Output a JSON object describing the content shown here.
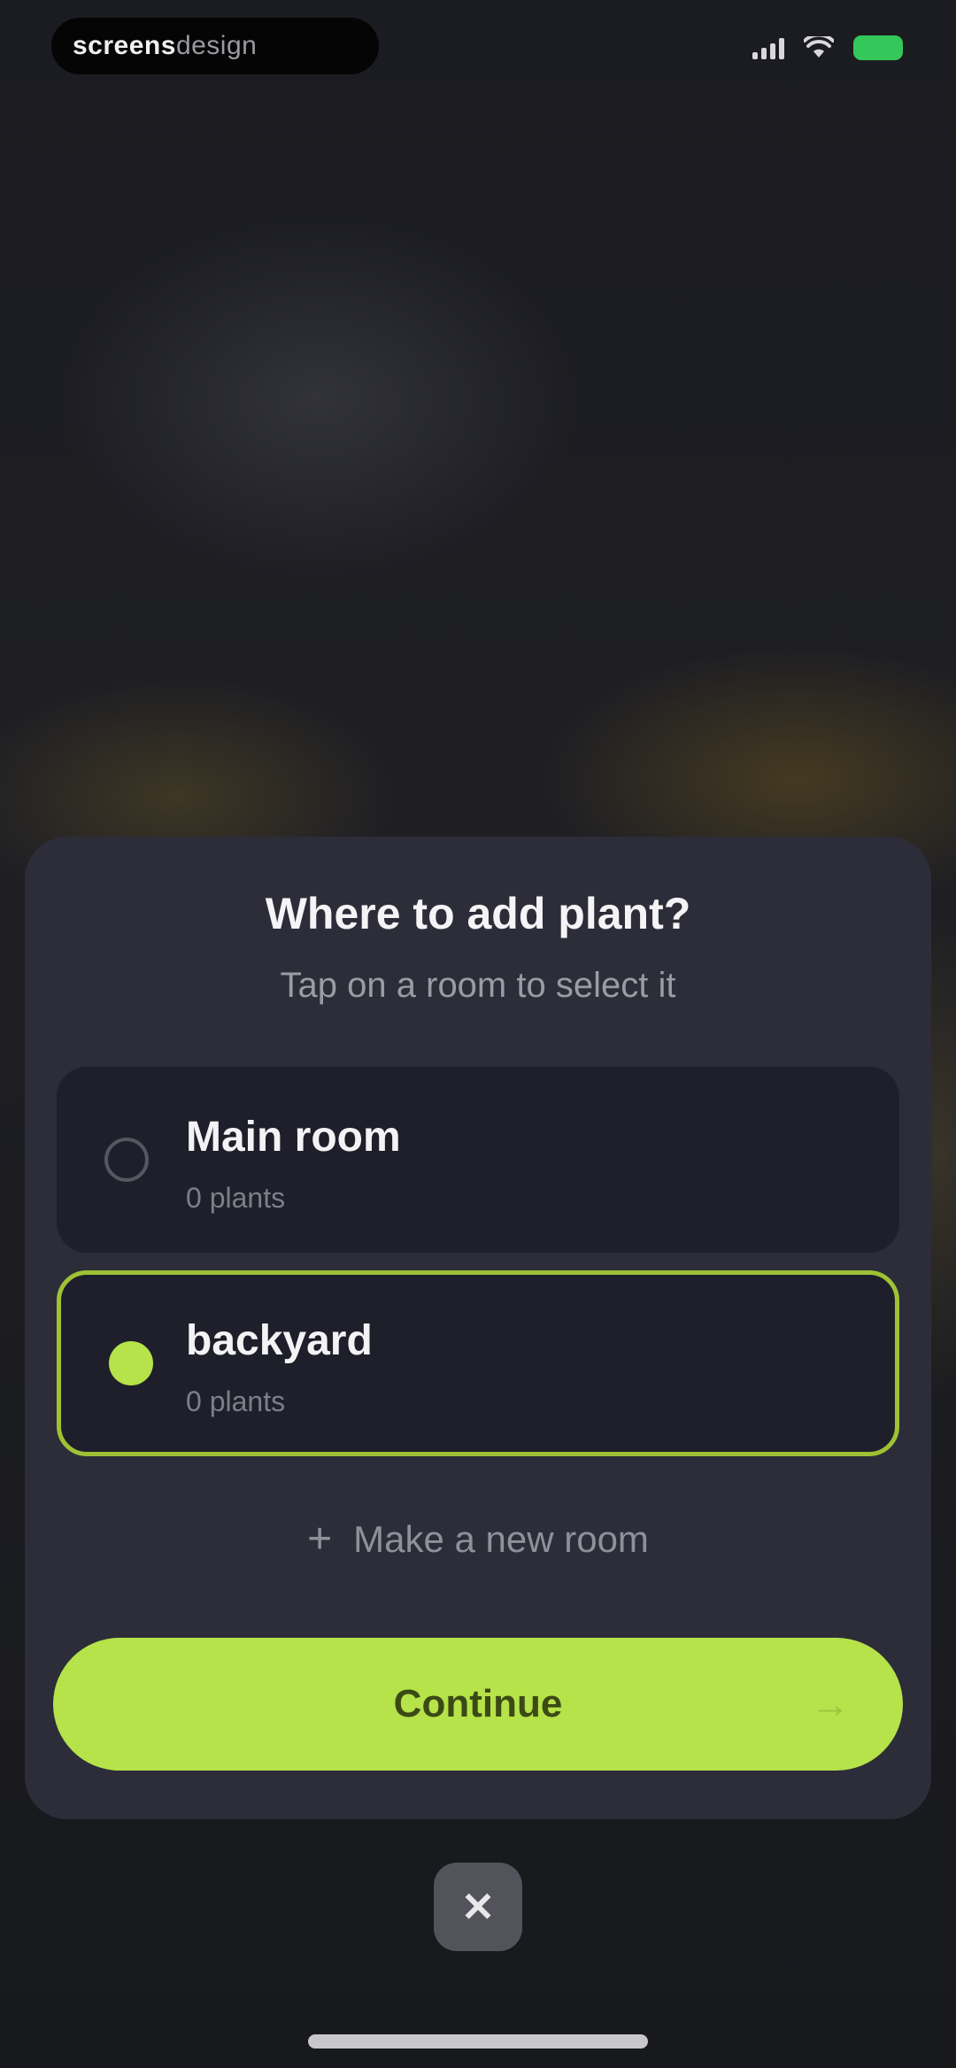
{
  "status_bar": {
    "brand_primary": "screens",
    "brand_secondary": "design",
    "battery_color": "#34c759",
    "icons": [
      "signal-icon",
      "wifi-icon",
      "battery-icon"
    ]
  },
  "sheet": {
    "title": "Where to add plant?",
    "subtitle": "Tap on a room to select it",
    "rooms": [
      {
        "name": "Main room",
        "count": "0 plants",
        "selected": false
      },
      {
        "name": "backyard",
        "count": "0 plants",
        "selected": true
      }
    ],
    "make_room_label": "Make a new room",
    "make_room_icon": "plus-icon",
    "continue_label": "Continue",
    "continue_icon": "arrow-right-icon"
  },
  "close_icon": "close-icon",
  "colors": {
    "accent": "#b6e24a",
    "sheet_background": "#2c2d38",
    "card_background": "#1f1f2b"
  }
}
